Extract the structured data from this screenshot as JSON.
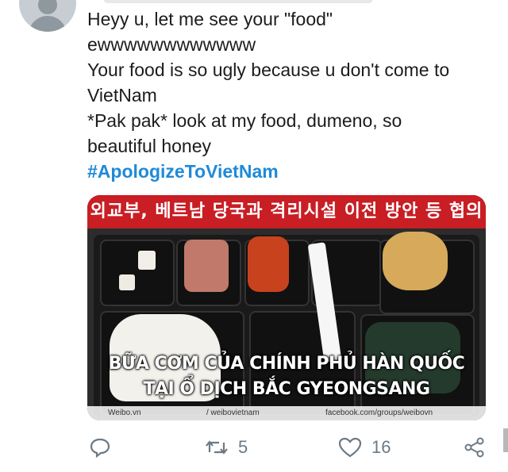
{
  "tweet": {
    "lines": [
      "Heyy u, let me see your \"food\"",
      "ewwwwwwwwwwww",
      "Your food is so ugly because u don't come to",
      "VietNam",
      "*Pak pak* look at my food, dumeno, so",
      "beautiful honey"
    ],
    "hashtag": "#ApologizeToVietNam"
  },
  "media": {
    "banner_text": "외교부, 베트남 당국과 격리시설 이전 방안 등 협의",
    "caption_line1": "BỮA CƠM CỦA  CHÍNH PHỦ HÀN QUỐC",
    "caption_line2": "TẠI Ổ DỊCH BẮC GYEONGSANG",
    "source_weibo": "Weibo.vn",
    "source_web": "/ weibovietnam",
    "source_facebook": "facebook.com/groups/weibovn"
  },
  "actions": {
    "retweet_count": "5",
    "like_count": "16"
  },
  "colors": {
    "hashtag": "#1f8ad8",
    "banner": "#c81e24",
    "icon": "#6b7a86"
  }
}
